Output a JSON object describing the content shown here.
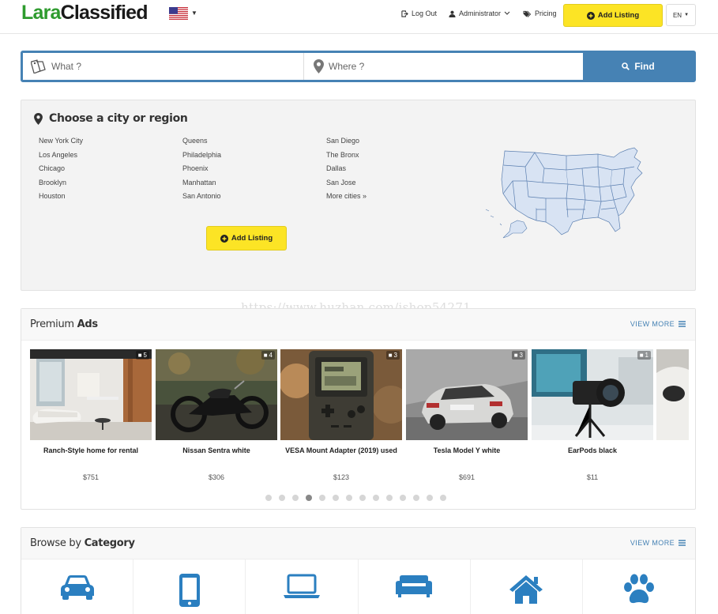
{
  "header": {
    "logo_part1": "Lara",
    "logo_part2": "Classified",
    "nav": {
      "logout": "Log Out",
      "user": "Administrator",
      "pricing": "Pricing"
    },
    "add_listing": "Add Listing",
    "language": "EN"
  },
  "search": {
    "what_placeholder": "What ?",
    "where_placeholder": "Where ?",
    "find_label": "Find"
  },
  "locations": {
    "title": "Choose a city or region",
    "columns": [
      [
        "New York City",
        "Los Angeles",
        "Chicago",
        "Brooklyn",
        "Houston"
      ],
      [
        "Queens",
        "Philadelphia",
        "Phoenix",
        "Manhattan",
        "San Antonio"
      ],
      [
        "San Diego",
        "The Bronx",
        "Dallas",
        "San Jose",
        "More cities »"
      ]
    ],
    "add_listing": "Add Listing"
  },
  "watermark": "https://www.huzhan.com/ishop54271",
  "premium": {
    "title_light": "Premium",
    "title_bold": "Ads",
    "view_more": "VIEW MORE",
    "ads": [
      {
        "title": "Ranch-Style home for rental",
        "price": "$751",
        "photos": "5",
        "icon": "house-photo"
      },
      {
        "title": "Nissan Sentra white",
        "price": "$306",
        "photos": "4",
        "icon": "motorcycle-photo"
      },
      {
        "title": "VESA Mount Adapter (2019) used",
        "price": "$123",
        "photos": "3",
        "icon": "gameboy-photo"
      },
      {
        "title": "Tesla Model Y white",
        "price": "$691",
        "photos": "3",
        "icon": "car-photo"
      },
      {
        "title": "EarPods black",
        "price": "$11",
        "photos": "1",
        "icon": "camera-photo"
      }
    ],
    "dots_total": 14,
    "dots_active": 4
  },
  "categories": {
    "title_light": "Browse by",
    "title_bold": "Category",
    "view_more": "VIEW MORE",
    "items": [
      "car-icon",
      "mobile-phone-icon",
      "laptop-icon",
      "sofa-icon",
      "home-icon",
      "paw-icon"
    ]
  },
  "colors": {
    "brand_green": "#2e9b2e",
    "accent_yellow": "#fce425",
    "primary_blue": "#4682b4",
    "icon_blue": "#2b7fc0"
  }
}
